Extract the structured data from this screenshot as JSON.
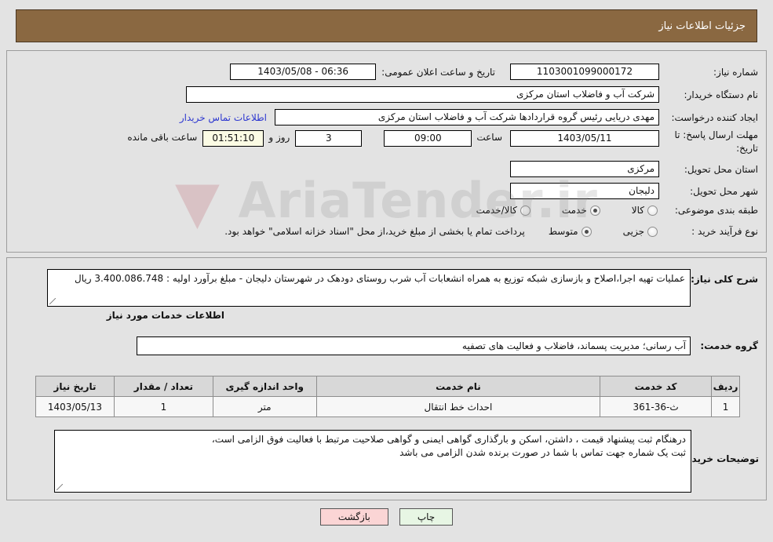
{
  "header": {
    "title": "جزئیات اطلاعات نیاز"
  },
  "watermark": {
    "text": "AriaTender.ir"
  },
  "form": {
    "need_number": {
      "label": "شماره نیاز:",
      "value": "1103001099000172"
    },
    "announce_datetime": {
      "label": "تاریخ و ساعت اعلان عمومی:",
      "value": "06:36 - 1403/05/08"
    },
    "buyer_org": {
      "label": "نام دستگاه خریدار:",
      "value": "شرکت آب و فاضلاب استان مرکزی"
    },
    "request_creator": {
      "label": "ایجاد کننده درخواست:",
      "value": "مهدی دریایی رئیس گروه قراردادها شرکت آب و فاضلاب استان مرکزی"
    },
    "buyer_contact_link": "اطلاعات تماس خریدار",
    "deadline": {
      "label": "مهلت ارسال پاسخ: تا تاریخ:",
      "date": "1403/05/11",
      "time_label": "ساعت",
      "time": "09:00",
      "days": "3",
      "days_label": "روز و",
      "countdown": "01:51:10",
      "remaining_label": "ساعت باقی مانده"
    },
    "delivery_province": {
      "label": "استان محل تحویل:",
      "value": "مرکزی"
    },
    "delivery_city": {
      "label": "شهر محل تحویل:",
      "value": "دلیجان"
    },
    "subject_category": {
      "label": "طبقه بندی موضوعی:",
      "options": [
        {
          "label": "کالا",
          "selected": false
        },
        {
          "label": "خدمت",
          "selected": true
        },
        {
          "label": "کالا/خدمت",
          "selected": false
        }
      ]
    },
    "purchase_process": {
      "label": "نوع فرآیند خرید :",
      "options": [
        {
          "label": "جزیی",
          "selected": false
        },
        {
          "label": "متوسط",
          "selected": true
        }
      ],
      "note": "پرداخت تمام یا بخشی از مبلغ خرید،از محل \"اسناد خزانه اسلامی\" خواهد بود."
    }
  },
  "details": {
    "general_description": {
      "label": "شرح کلی نیاز:",
      "value": "عملیات تهیه اجرا،اصلاح و بازسازی شبکه توزیع به همراه انشعابات آب شرب روستای دودهک در شهرستان دلیجان - مبلغ برآورد اولیه : 3.400.086.748 ریال"
    },
    "services_heading": "اطلاعات خدمات مورد نیاز",
    "service_group": {
      "label": "گروه خدمت:",
      "value": "آب رسانی؛ مدیریت پسماند، فاضلاب و فعالیت های تصفیه"
    },
    "table": {
      "headers": [
        "ردیف",
        "کد خدمت",
        "نام خدمت",
        "واحد اندازه گیری",
        "تعداد / مقدار",
        "تاریخ نیاز"
      ],
      "rows": [
        [
          "1",
          "ث-36-361",
          "احداث خط انتقال",
          "متر",
          "1",
          "1403/05/13"
        ]
      ]
    },
    "buyer_notes": {
      "label": "توضیحات خریدار:",
      "line1": "درهنگام ثبت پیشنهاد قیمت ، داشتن، اسکن و بارگذاری گواهی ایمنی و گواهی صلاحیت مرتبط با فعالیت فوق الزامی است،",
      "line2": "ثبت یک شماره جهت تماس با شما در صورت برنده شدن الزامی می باشد"
    }
  },
  "buttons": {
    "back": "بازگشت",
    "print": "چاپ"
  },
  "colors": {
    "header_bg": "#8a6841",
    "link": "#2d37d0",
    "back_btn": "#fbd5d5",
    "print_btn": "#e7f6e4",
    "countdown_bg": "#fbfbe4"
  }
}
